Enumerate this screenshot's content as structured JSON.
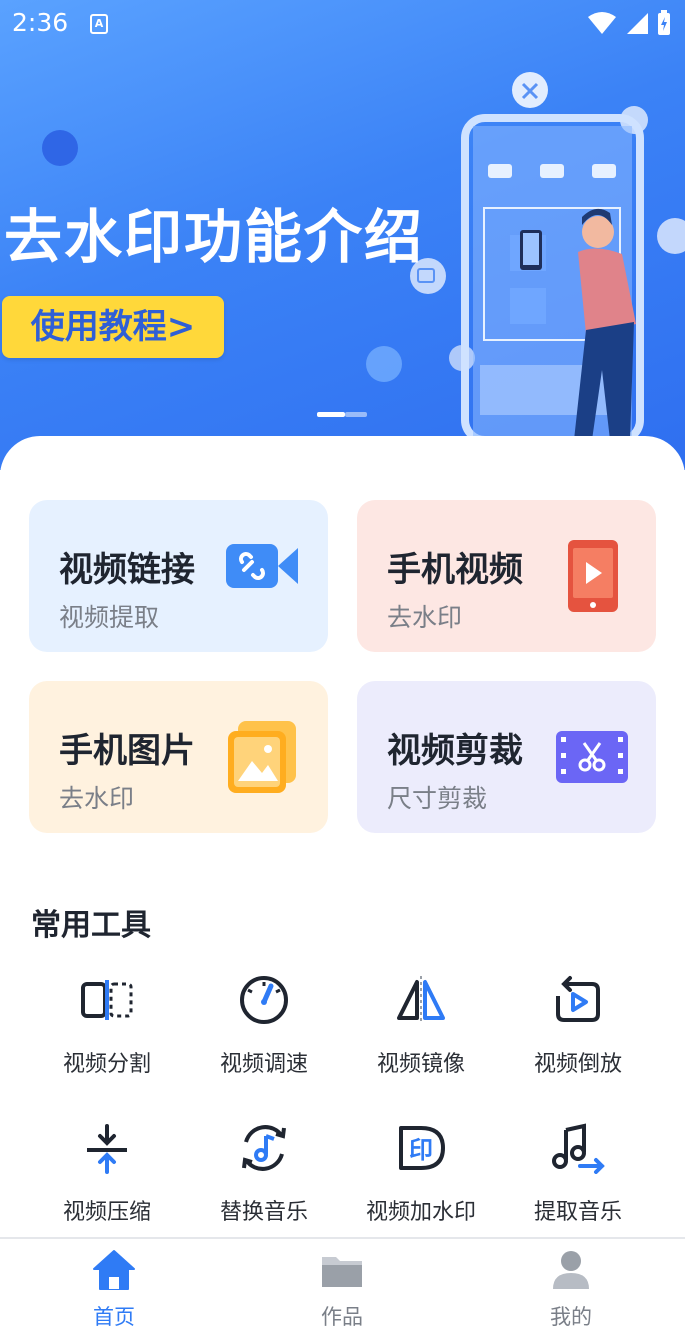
{
  "status_bar": {
    "time": "2:36",
    "notif_icon": "A"
  },
  "banner": {
    "title": "去水印功能介绍",
    "button_label": "使用教程>",
    "slides": 2,
    "active_slide": 1
  },
  "cards": [
    {
      "title": "视频链接",
      "subtitle": "视频提取",
      "icon": "link-video-icon",
      "bg": "#e8f2ff"
    },
    {
      "title": "手机视频",
      "subtitle": "去水印",
      "icon": "phone-play-icon",
      "bg": "#fde8e6"
    },
    {
      "title": "手机图片",
      "subtitle": "去水印",
      "icon": "image-icon",
      "bg": "#fff3e0"
    },
    {
      "title": "视频剪裁",
      "subtitle": "尺寸剪裁",
      "icon": "film-scissors-icon",
      "bg": "#ececfd"
    }
  ],
  "tools_section": {
    "title": "常用工具",
    "tools": [
      {
        "label": "视频分割",
        "icon": "split-icon"
      },
      {
        "label": "视频调速",
        "icon": "speed-icon"
      },
      {
        "label": "视频镜像",
        "icon": "mirror-icon"
      },
      {
        "label": "视频倒放",
        "icon": "reverse-icon"
      },
      {
        "label": "视频压缩",
        "icon": "compress-icon"
      },
      {
        "label": "替换音乐",
        "icon": "replace-music-icon"
      },
      {
        "label": "视频加水印",
        "icon": "add-watermark-icon"
      },
      {
        "label": "提取音乐",
        "icon": "extract-music-icon"
      }
    ]
  },
  "bottom_nav": {
    "items": [
      {
        "label": "首页",
        "icon": "home-icon",
        "active": true
      },
      {
        "label": "作品",
        "icon": "folder-icon",
        "active": false
      },
      {
        "label": "我的",
        "icon": "user-icon",
        "active": false
      }
    ]
  },
  "colors": {
    "accent": "#2f7bf5",
    "inactive": "#9aa0a8",
    "banner_button": "#ffd83a"
  }
}
